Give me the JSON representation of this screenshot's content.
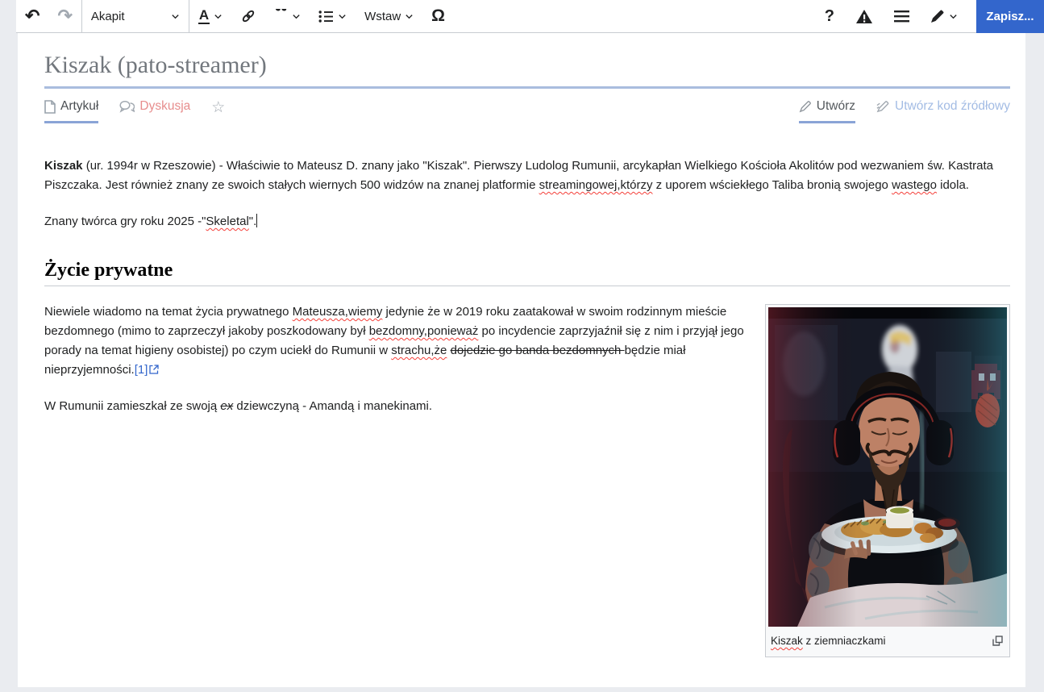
{
  "toolbar": {
    "paragraph_label": "Akapit",
    "insert_label": "Wstaw",
    "save_label": "Zapisz..."
  },
  "icons": {
    "undo": "↶",
    "redo": "↷",
    "text_style": "A",
    "quote": "“",
    "omega": "Ω",
    "help": "?",
    "star": "☆"
  },
  "header": {
    "title": "Kiszak (pato-streamer)",
    "tab_article": "Artykuł",
    "tab_discussion": "Dyskusja",
    "tab_create": "Utwórz",
    "tab_create_source": "Utwórz kod źródłowy"
  },
  "article": {
    "p1": {
      "bold": "Kiszak",
      "t1": " (ur. 1994r w Rzeszowie) - Właściwie to Mateusz D. znany jako \"Kiszak\". Pierwszy Ludolog Rumunii, arcykapłan Wielkiego Kościoła Akolitów pod wezwaniem św. Kastrata Piszczaka. Jest również znany ze swoich stałych wiernych 500 widzów na znanej platformie ",
      "sp1": "streamingowej,którzy",
      "t2": " z uporem wściekłego Taliba bronią swojego ",
      "sp2": "wastego",
      "t3": " idola."
    },
    "p2": {
      "t1": "Znany twórca gry roku 2025 -\"",
      "sp1": "Skeletal",
      "t2": "\"."
    },
    "h2": "Życie prywatne",
    "p3": {
      "t1": "Niewiele wiadomo na temat życia prywatnego ",
      "sp1": "Mateusza,wiemy",
      "t2": " jedynie że w 2019 roku zaatakował w swoim rodzinnym mieście bezdomnego (mimo to zaprzeczył jakoby poszkodowany był ",
      "sp2": "bezdomny,ponieważ",
      "t3": " po incydencie zaprzyjaźnił się z nim i przyjął jego porady na temat higieny osobistej) po czym uciekł do Rumunii w ",
      "sp3": "strachu,że",
      "t4": " ",
      "strike": "dojedzie go banda bezdomnych ",
      "t5": "będzie miał nieprzyjemności.",
      "ref": "[1]"
    },
    "p4": {
      "t1": "W Rumunii zamieszkał ze swoją  ",
      "strike": "ex",
      "t2": " dziewczyną - Amandą i manekinami."
    }
  },
  "thumbnail": {
    "caption_word": "Kiszak",
    "caption_rest": " z ziemniaczkami"
  },
  "colors": {
    "accent_blue": "#3366cc",
    "save_button": "#3366cc",
    "title_rule": "#a9bdde",
    "tab_underline": "#8aa4d6",
    "redlink": "#e78d8d",
    "source_link": "#a3bce4",
    "spellcheck_red": "#f4403a",
    "toolbar_border": "#c8ccd1",
    "page_background": "#eaecf0"
  }
}
